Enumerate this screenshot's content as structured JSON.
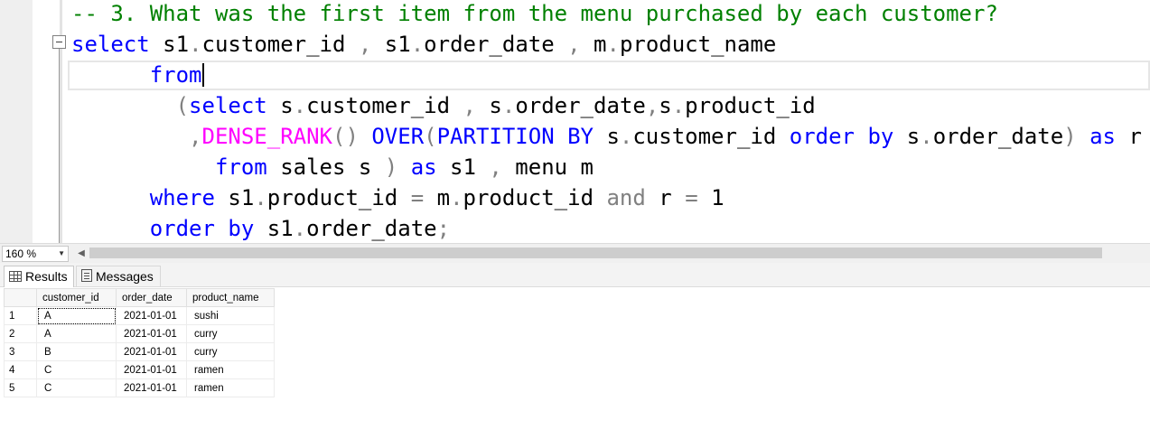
{
  "editor": {
    "lines": [
      {
        "tokens": [
          {
            "t": "-- 3. What was the first item from the menu purchased by each customer?",
            "c": "comment"
          }
        ]
      },
      {
        "tokens": [
          {
            "t": "select",
            "c": "kw"
          },
          {
            "t": " s1",
            "c": "plain"
          },
          {
            "t": ".",
            "c": "punct"
          },
          {
            "t": "customer_id ",
            "c": "plain"
          },
          {
            "t": ",",
            "c": "punct"
          },
          {
            "t": " s1",
            "c": "plain"
          },
          {
            "t": ".",
            "c": "punct"
          },
          {
            "t": "order_date ",
            "c": "plain"
          },
          {
            "t": ",",
            "c": "punct"
          },
          {
            "t": " m",
            "c": "plain"
          },
          {
            "t": ".",
            "c": "punct"
          },
          {
            "t": "product_name",
            "c": "plain"
          }
        ]
      },
      {
        "tokens": [
          {
            "t": "      from",
            "c": "kw"
          },
          {
            "t": "|",
            "c": "caret"
          }
        ]
      },
      {
        "tokens": [
          {
            "t": "        (",
            "c": "punct"
          },
          {
            "t": "select",
            "c": "kw"
          },
          {
            "t": " s",
            "c": "plain"
          },
          {
            "t": ".",
            "c": "punct"
          },
          {
            "t": "customer_id ",
            "c": "plain"
          },
          {
            "t": ",",
            "c": "punct"
          },
          {
            "t": " s",
            "c": "plain"
          },
          {
            "t": ".",
            "c": "punct"
          },
          {
            "t": "order_date",
            "c": "plain"
          },
          {
            "t": ",",
            "c": "punct"
          },
          {
            "t": "s",
            "c": "plain"
          },
          {
            "t": ".",
            "c": "punct"
          },
          {
            "t": "product_id",
            "c": "plain"
          }
        ]
      },
      {
        "tokens": [
          {
            "t": "         ,",
            "c": "punct"
          },
          {
            "t": "DENSE_RANK",
            "c": "fn"
          },
          {
            "t": "()",
            "c": "punct"
          },
          {
            "t": " ",
            "c": "plain"
          },
          {
            "t": "OVER",
            "c": "kw"
          },
          {
            "t": "(",
            "c": "punct"
          },
          {
            "t": "PARTITION BY",
            "c": "kw"
          },
          {
            "t": " s",
            "c": "plain"
          },
          {
            "t": ".",
            "c": "punct"
          },
          {
            "t": "customer_id ",
            "c": "plain"
          },
          {
            "t": "order by",
            "c": "kw"
          },
          {
            "t": " s",
            "c": "plain"
          },
          {
            "t": ".",
            "c": "punct"
          },
          {
            "t": "order_date",
            "c": "plain"
          },
          {
            "t": ")",
            "c": "punct"
          },
          {
            "t": " as",
            "c": "kw"
          },
          {
            "t": " r",
            "c": "plain"
          }
        ]
      },
      {
        "tokens": [
          {
            "t": "           from",
            "c": "kw"
          },
          {
            "t": " sales s ",
            "c": "plain"
          },
          {
            "t": ")",
            "c": "punct"
          },
          {
            "t": " as",
            "c": "kw"
          },
          {
            "t": " s1 ",
            "c": "plain"
          },
          {
            "t": ",",
            "c": "punct"
          },
          {
            "t": " menu m",
            "c": "plain"
          }
        ]
      },
      {
        "tokens": [
          {
            "t": "      where",
            "c": "kw"
          },
          {
            "t": " s1",
            "c": "plain"
          },
          {
            "t": ".",
            "c": "punct"
          },
          {
            "t": "product_id ",
            "c": "plain"
          },
          {
            "t": "=",
            "c": "punct"
          },
          {
            "t": " m",
            "c": "plain"
          },
          {
            "t": ".",
            "c": "punct"
          },
          {
            "t": "product_id ",
            "c": "plain"
          },
          {
            "t": "and",
            "c": "punct"
          },
          {
            "t": " r ",
            "c": "plain"
          },
          {
            "t": "=",
            "c": "punct"
          },
          {
            "t": " 1",
            "c": "plain"
          }
        ]
      },
      {
        "tokens": [
          {
            "t": "      order by",
            "c": "kw"
          },
          {
            "t": " s1",
            "c": "plain"
          },
          {
            "t": ".",
            "c": "punct"
          },
          {
            "t": "order_date",
            "c": "plain"
          },
          {
            "t": ";",
            "c": "punct"
          }
        ]
      }
    ]
  },
  "zoom": {
    "value": "160 %"
  },
  "tabs": {
    "results": "Results",
    "messages": "Messages"
  },
  "results": {
    "columns": [
      "customer_id",
      "order_date",
      "product_name"
    ],
    "rows": [
      {
        "n": "1",
        "customer_id": "A",
        "order_date": "2021-01-01",
        "product_name": "sushi"
      },
      {
        "n": "2",
        "customer_id": "A",
        "order_date": "2021-01-01",
        "product_name": "curry"
      },
      {
        "n": "3",
        "customer_id": "B",
        "order_date": "2021-01-01",
        "product_name": "curry"
      },
      {
        "n": "4",
        "customer_id": "C",
        "order_date": "2021-01-01",
        "product_name": "ramen"
      },
      {
        "n": "5",
        "customer_id": "C",
        "order_date": "2021-01-01",
        "product_name": "ramen"
      }
    ]
  },
  "colors": {
    "comment": "#008000",
    "keyword": "#0000ff",
    "function": "#ff00ff",
    "punctuation": "#808080"
  }
}
